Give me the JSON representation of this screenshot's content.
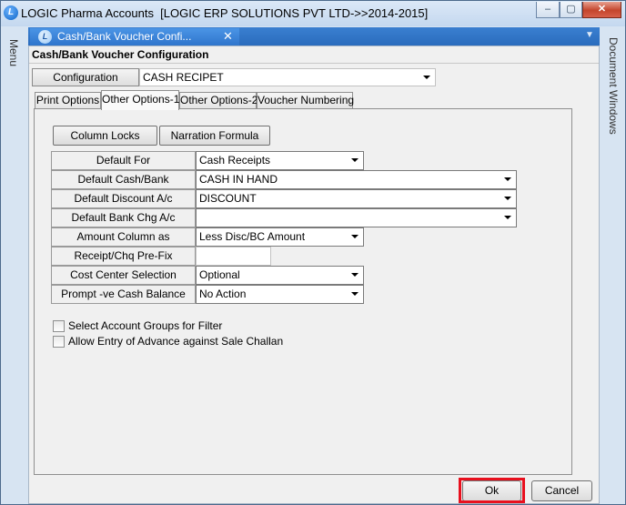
{
  "window": {
    "title": "LOGIC Pharma Accounts  [LOGIC ERP SOLUTIONS PVT LTD->>2014-2015]",
    "app_icon_letter": "L",
    "controls": {
      "minimize": "–",
      "maximize": "▢",
      "close": "✕"
    }
  },
  "left_rail": {
    "label": "Menu"
  },
  "right_rail": {
    "label": "Document Windows"
  },
  "doc_tab": {
    "title": "Cash/Bank Voucher Confi...",
    "close": "✕",
    "chevron": "▼"
  },
  "form": {
    "title": "Cash/Bank Voucher Configuration",
    "config_button": "Configuration",
    "config_value": "CASH RECIPET"
  },
  "tabs": [
    "Print Options",
    "Other Options-1",
    "Other Options-2",
    "Voucher Numbering"
  ],
  "active_tab": "Other Options-1",
  "panel_buttons": {
    "column_locks": "Column Locks",
    "narration_formula": "Narration Formula"
  },
  "fields": [
    {
      "label": "Default For",
      "value": "Cash Receipts",
      "type": "select"
    },
    {
      "label": "Default Cash/Bank",
      "value": "CASH IN HAND",
      "type": "select"
    },
    {
      "label": "Default Discount A/c",
      "value": "DISCOUNT",
      "type": "select"
    },
    {
      "label": "Default Bank Chg A/c",
      "value": "",
      "type": "select"
    },
    {
      "label": "Amount Column as",
      "value": "Less Disc/BC Amount",
      "type": "select"
    },
    {
      "label": "Receipt/Chq Pre-Fix",
      "value": "",
      "type": "text"
    },
    {
      "label": "Cost Center Selection",
      "value": "Optional",
      "type": "select"
    },
    {
      "label": "Prompt -ve Cash Balance",
      "value": "No Action",
      "type": "select"
    }
  ],
  "checkboxes": [
    {
      "label": "Select Account Groups for Filter",
      "checked": false
    },
    {
      "label": "Allow Entry of Advance against Sale Challan",
      "checked": false
    }
  ],
  "footer": {
    "ok": "Ok",
    "cancel": "Cancel"
  },
  "colors": {
    "highlight": "#e8101e",
    "tabstrip": "#2f75cc"
  }
}
